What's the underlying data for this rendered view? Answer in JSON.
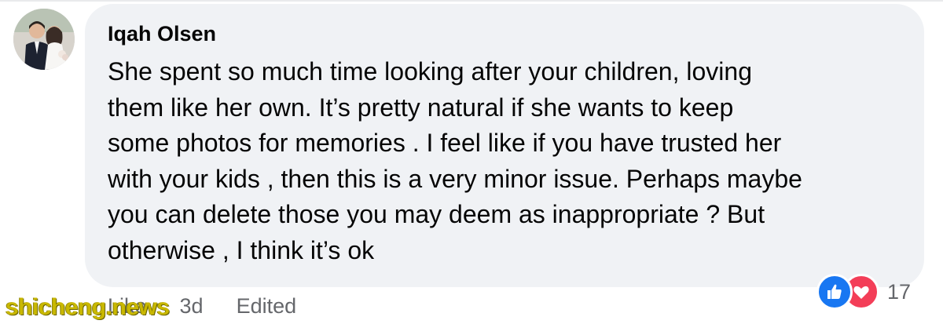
{
  "comment": {
    "author": "Iqah Olsen",
    "lines": [
      "She spent so much time looking after your children, loving",
      "them like her own. It’s pretty natural if she wants to keep",
      "some photos for memories . I feel like if you have trusted her",
      "with your kids , then this is a very minor issue. Perhaps maybe",
      "you can delete those you may deem as inappropriate ? But",
      "otherwise , I think it’s ok"
    ]
  },
  "actions": {
    "like_label": "Like",
    "time": "3d",
    "edited_label": "Edited"
  },
  "reactions": {
    "icons": [
      "like-icon",
      "love-icon"
    ],
    "count": "17",
    "colors": {
      "like": "#1877f2",
      "love": "#f33e58"
    }
  },
  "watermark": "shicheng.news"
}
